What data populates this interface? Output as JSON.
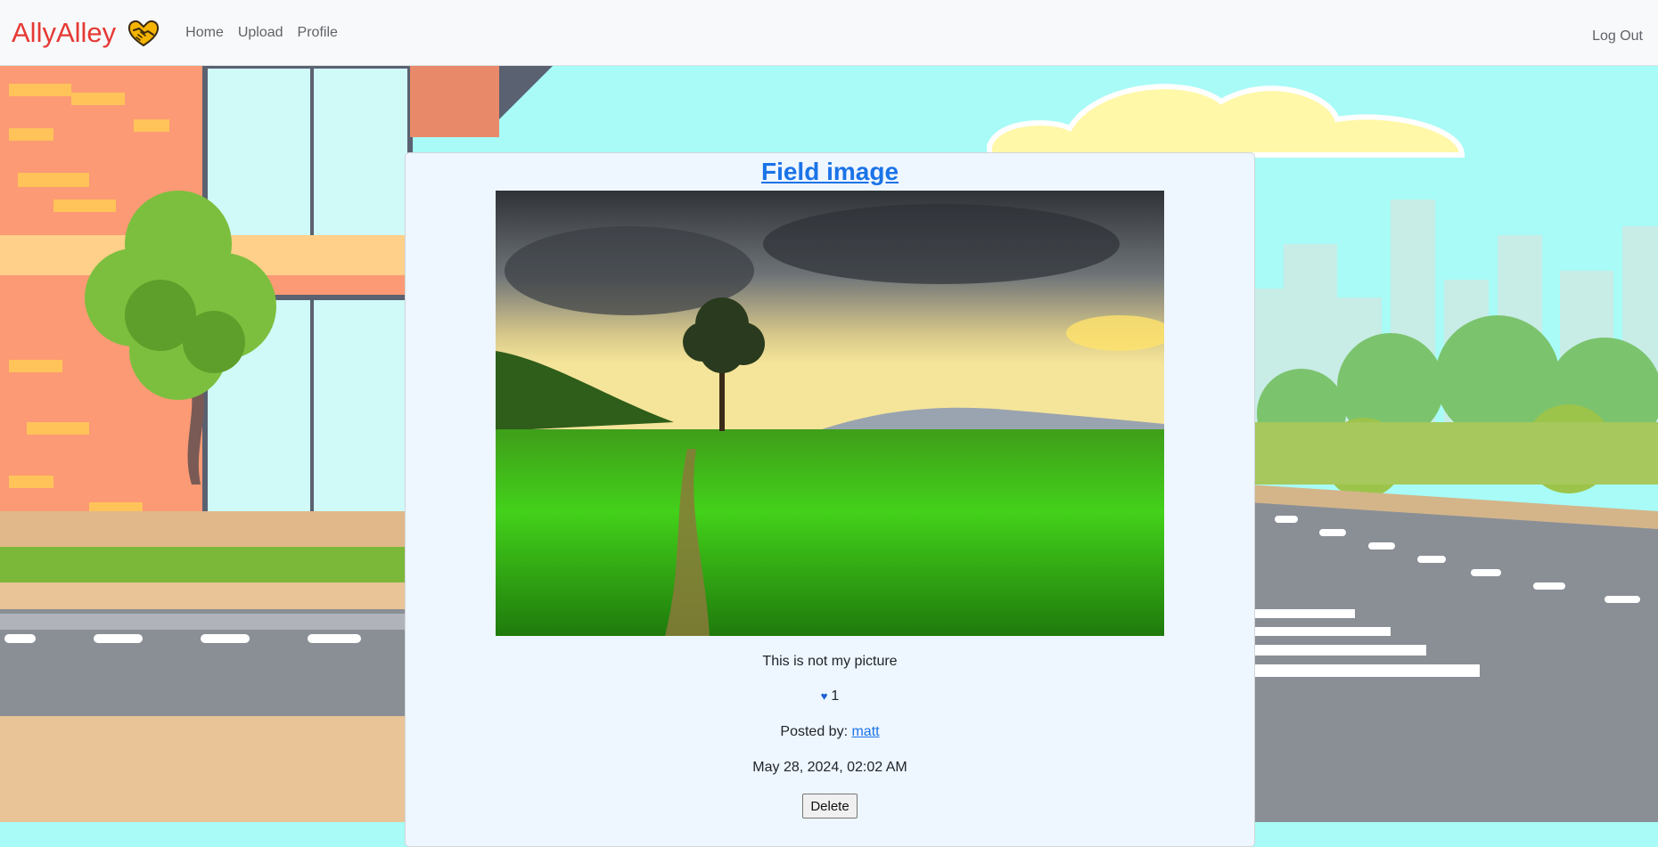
{
  "navbar": {
    "brand": "AllyAlley",
    "links": [
      "Home",
      "Upload",
      "Profile"
    ],
    "logout": "Log Out"
  },
  "post": {
    "title": "Field image",
    "caption": "This is not my picture",
    "likes": "1",
    "posted_by_label": "Posted by:",
    "author": "matt",
    "date": "May 28, 2024, 02:02 AM",
    "delete_label": "Delete"
  },
  "colors": {
    "brand": "#e53935",
    "link": "#1a73e8",
    "card_bg": "#eef6ff",
    "navbar_bg": "#f8f9fa"
  },
  "icons": {
    "brand_logo": "handshake-heart-icon",
    "like": "heart-icon"
  }
}
